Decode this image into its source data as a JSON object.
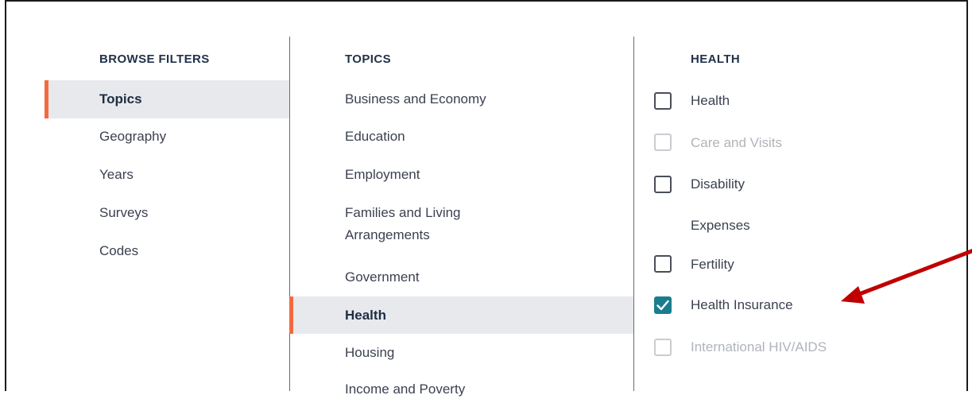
{
  "filters": {
    "heading": "BROWSE FILTERS",
    "items": [
      "Topics",
      "Geography",
      "Years",
      "Surveys",
      "Codes"
    ]
  },
  "topics": {
    "heading": "TOPICS",
    "items": [
      "Business and Economy",
      "Education",
      "Employment",
      "Families and Living",
      "Arrangements",
      "Government",
      "Health",
      "Housing",
      "Income and Poverty"
    ]
  },
  "health": {
    "heading": "HEALTH",
    "options": [
      {
        "label": "Health",
        "state": "unchecked"
      },
      {
        "label": "Care and Visits",
        "state": "disabled"
      },
      {
        "label": "Disability",
        "state": "unchecked"
      },
      {
        "label": "Expenses",
        "state": "none"
      },
      {
        "label": "Fertility",
        "state": "unchecked"
      },
      {
        "label": "Health Insurance",
        "state": "checked"
      },
      {
        "label": "International HIV/AIDS",
        "state": "disabled"
      }
    ]
  },
  "colors": {
    "accent": "#f26a3d",
    "checked": "#1a7d8f",
    "annotation_arrow": "#c00000"
  }
}
